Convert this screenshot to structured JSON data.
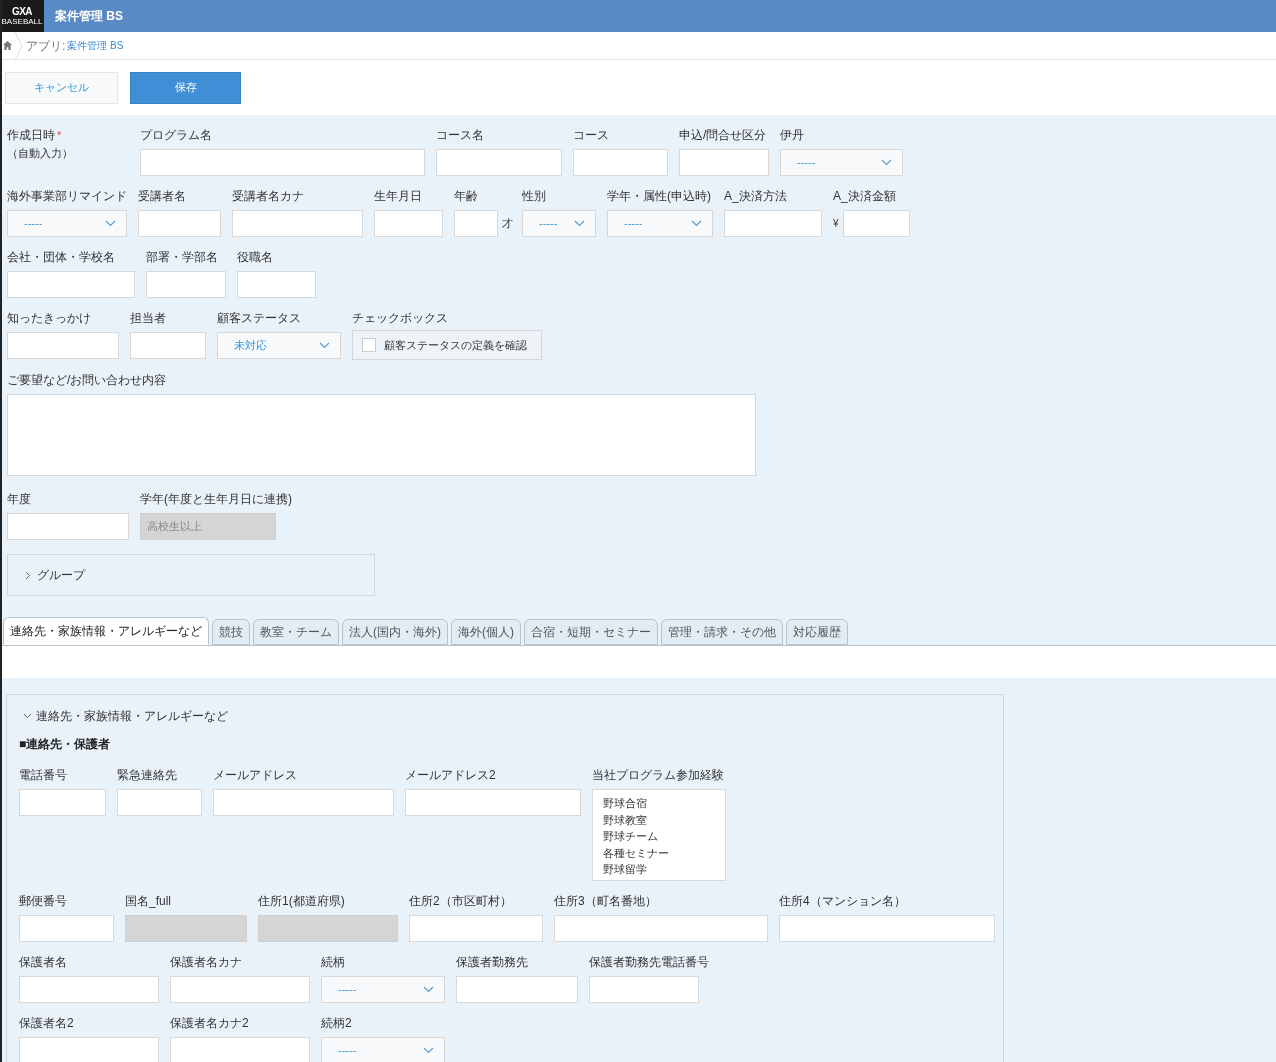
{
  "header": {
    "logo": "GXA",
    "logo_sub": "BASEBALL",
    "title": "案件管理 BS"
  },
  "breadcrumb": {
    "prefix": "アプリ:",
    "link": "案件管理 BS"
  },
  "buttons": {
    "cancel": "キャンセル",
    "save": "保存"
  },
  "form_rows": [
    [
      {
        "kind": "auto",
        "label": "作成日時",
        "required_mark": "*",
        "note": "（自動入力）"
      },
      {
        "kind": "text",
        "label": "プログラム名"
      },
      {
        "kind": "text",
        "label": "コース名"
      },
      {
        "kind": "text",
        "label": "コース"
      },
      {
        "kind": "text",
        "label": "申込/問合せ区分"
      },
      {
        "kind": "select",
        "label": "伊丹",
        "value": "-----"
      }
    ],
    [
      {
        "kind": "select",
        "label": "海外事業部リマインド",
        "value": "-----"
      },
      {
        "kind": "text",
        "label": "受講者名"
      },
      {
        "kind": "text",
        "label": "受講者名カナ"
      },
      {
        "kind": "text",
        "label": "生年月日"
      },
      {
        "kind": "text",
        "label": "年齢",
        "suffix": "才"
      },
      {
        "kind": "select",
        "label": "性別",
        "value": "-----"
      },
      {
        "kind": "select",
        "label": "学年・属性(申込時)",
        "value": "-----"
      },
      {
        "kind": "text",
        "label": "A_決済方法"
      },
      {
        "kind": "text",
        "label": "A_決済金額",
        "prefix": "¥"
      }
    ],
    [
      {
        "kind": "text",
        "label": "会社・団体・学校名"
      },
      {
        "kind": "text",
        "label": "部署・学部名"
      },
      {
        "kind": "text",
        "label": "役職名"
      }
    ],
    [
      {
        "kind": "text",
        "label": "知ったきっかけ"
      },
      {
        "kind": "text",
        "label": "担当者"
      },
      {
        "kind": "select",
        "label": "顧客ステータス",
        "value": "未対応"
      },
      {
        "kind": "checkbox",
        "label": "チェックボックス",
        "option": "顧客ステータスの定義を確認",
        "checked": false
      }
    ],
    [
      {
        "kind": "textarea",
        "label": "ご要望など/お問い合わせ内容"
      }
    ],
    [
      {
        "kind": "text",
        "label": "年度"
      },
      {
        "kind": "readonly",
        "label": "学年(年度と生年月日に連携)",
        "value": "高校生以上"
      }
    ]
  ],
  "group": {
    "label": "グループ",
    "expanded": false
  },
  "tabs": [
    {
      "label": "連絡先・家族情報・アレルギーなど",
      "selected": true
    },
    {
      "label": "競技",
      "selected": false
    },
    {
      "label": "教室・チーム",
      "selected": false
    },
    {
      "label": "法人(国内・海外)",
      "selected": false
    },
    {
      "label": "海外(個人)",
      "selected": false
    },
    {
      "label": "合宿・短期・セミナー",
      "selected": false
    },
    {
      "label": "管理・請求・その他",
      "selected": false
    },
    {
      "label": "対応履歴",
      "selected": false
    }
  ],
  "section": {
    "label": "連絡先・家族情報・アレルギーなど",
    "expanded": true,
    "heading": "■連絡先・保護者",
    "rows": [
      [
        {
          "kind": "text",
          "label": "電話番号"
        },
        {
          "kind": "text",
          "label": "緊急連絡先"
        },
        {
          "kind": "text",
          "label": "メールアドレス"
        },
        {
          "kind": "text",
          "label": "メールアドレス2"
        },
        {
          "kind": "listbox",
          "label": "当社プログラム参加経験",
          "items": [
            "野球合宿",
            "野球教室",
            "野球チーム",
            "各種セミナー",
            "野球留学"
          ]
        }
      ],
      [
        {
          "kind": "text",
          "label": "郵便番号"
        },
        {
          "kind": "readonly",
          "label": "国名_full"
        },
        {
          "kind": "readonly",
          "label": "住所1(都道府県)"
        },
        {
          "kind": "text",
          "label": "住所2（市区町村）"
        },
        {
          "kind": "text",
          "label": "住所3（町名番地）"
        },
        {
          "kind": "text",
          "label": "住所4（マンション名）"
        }
      ],
      [
        {
          "kind": "text",
          "label": "保護者名"
        },
        {
          "kind": "text",
          "label": "保護者名カナ"
        },
        {
          "kind": "select",
          "label": "続柄",
          "value": "-----"
        },
        {
          "kind": "text",
          "label": "保護者勤務先"
        },
        {
          "kind": "text",
          "label": "保護者勤務先電話番号"
        }
      ],
      [
        {
          "kind": "text",
          "label": "保護者名2"
        },
        {
          "kind": "text",
          "label": "保護者名カナ2"
        },
        {
          "kind": "select",
          "label": "続柄2",
          "value": "-----"
        }
      ]
    ]
  }
}
